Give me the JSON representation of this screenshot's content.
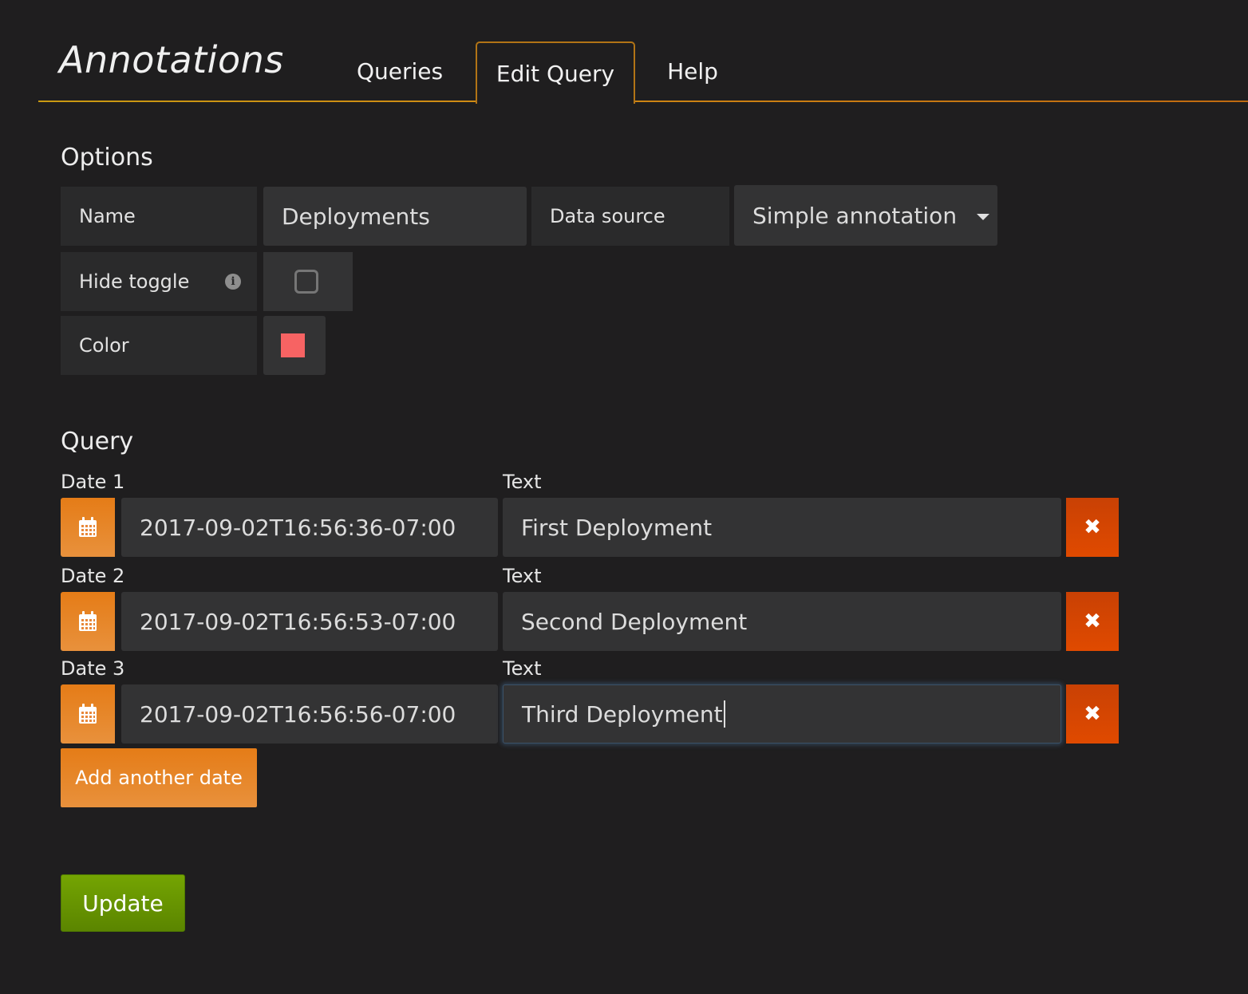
{
  "header": {
    "title": "Annotations",
    "tabs": [
      {
        "label": "Queries",
        "active": false
      },
      {
        "label": "Edit Query",
        "active": true
      },
      {
        "label": "Help",
        "active": false
      }
    ]
  },
  "options": {
    "section_title": "Options",
    "name_label": "Name",
    "name_value": "Deployments",
    "datasource_label": "Data source",
    "datasource_value": "Simple annotation",
    "hide_toggle_label": "Hide toggle",
    "hide_toggle_checked": false,
    "info_icon": "i",
    "color_label": "Color",
    "color_value": "#f76363"
  },
  "query": {
    "section_title": "Query",
    "rows": [
      {
        "date_label": "Date 1",
        "date_value": "2017-09-02T16:56:36-07:00",
        "text_label": "Text",
        "text_value": "First Deployment"
      },
      {
        "date_label": "Date 2",
        "date_value": "2017-09-02T16:56:53-07:00",
        "text_label": "Text",
        "text_value": "Second Deployment"
      },
      {
        "date_label": "Date 3",
        "date_value": "2017-09-02T16:56:56-07:00",
        "text_label": "Text",
        "text_value": "Third Deployment"
      }
    ],
    "delete_icon": "✖",
    "add_label": "Add another date"
  },
  "actions": {
    "update_label": "Update"
  },
  "colors": {
    "accent_orange": "#e57c17",
    "delete_red": "#d64500",
    "update_green": "#6a9a01",
    "tab_border": "#b27416"
  }
}
